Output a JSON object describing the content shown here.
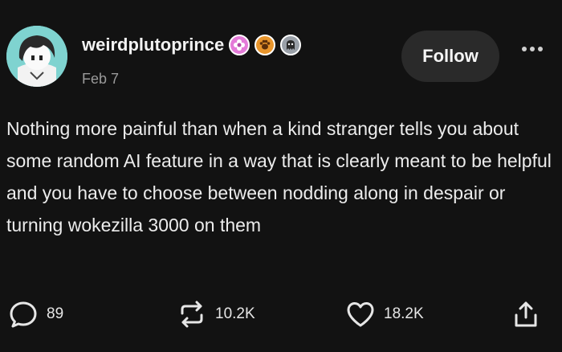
{
  "post": {
    "username": "weirdplutoprince",
    "date": "Feb 7",
    "follow_label": "Follow",
    "text": "Nothing more painful than when a kind stranger tells you about some random AI feature in a way that is clearly meant to be helpful and you have to choose between nodding along in despair or turning wokezilla 3000 on them",
    "badges": [
      {
        "icon": "pink-flower-badge-icon",
        "color": "#e47ad8"
      },
      {
        "icon": "orange-paw-badge-icon",
        "color": "#e8952c"
      },
      {
        "icon": "ghost-badge-icon",
        "color": "#9aa0a8"
      }
    ]
  },
  "actions": {
    "replies": "89",
    "reposts": "10.2K",
    "likes": "18.2K"
  },
  "icons": {
    "reply": "speech-bubble-icon",
    "repost": "repost-icon",
    "like": "heart-icon",
    "share": "share-icon",
    "more": "more-dots-icon"
  }
}
